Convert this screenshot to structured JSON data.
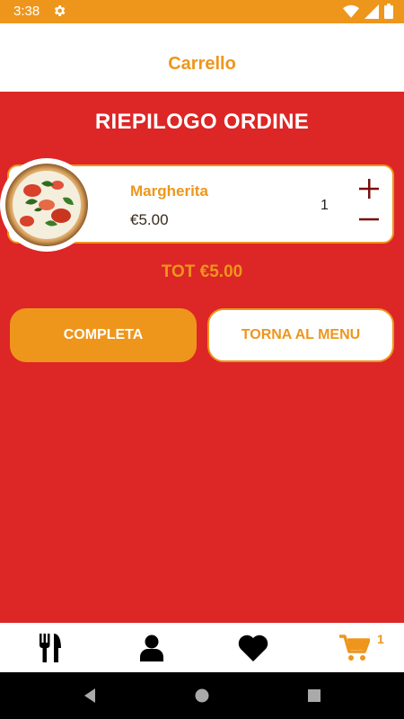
{
  "status_bar": {
    "time": "3:38"
  },
  "app_bar": {
    "title": "Carrello"
  },
  "summary": {
    "title": "RIEPILOGO ORDINE"
  },
  "cart_items": [
    {
      "name": "Margherita",
      "price": "€5.00",
      "quantity": "1"
    }
  ],
  "total": "TOT €5.00",
  "actions": {
    "complete_label": "COMPLETA",
    "back_label": "TORNA AL MENU"
  },
  "bottom_nav": {
    "items": [
      "menu-icon",
      "profile-icon",
      "favorites-icon",
      "cart-icon"
    ],
    "cart_count": "1"
  },
  "colors": {
    "primary": "#ee961c",
    "background": "#dd2626",
    "card": "#ffffff"
  }
}
